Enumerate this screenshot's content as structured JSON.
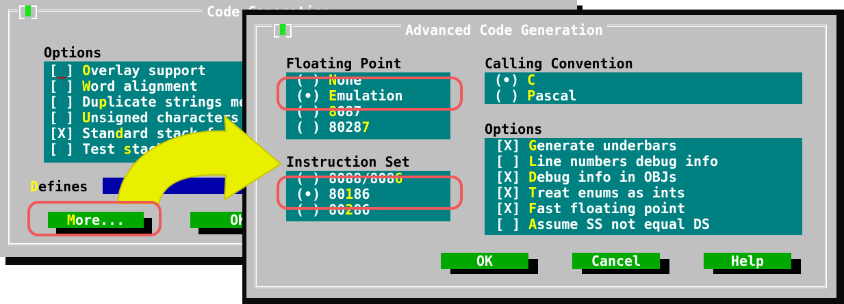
{
  "back_dialog": {
    "title": "Code Generation",
    "options_label": "Options",
    "options": [
      {
        "mark": "[_]",
        "hotkey": "O",
        "rest": "verlay support"
      },
      {
        "mark": "[ ]",
        "hotkey": "W",
        "rest": "ord alignment"
      },
      {
        "mark": "[ ]",
        "pre": "Du",
        "hotkey": "p",
        "rest": "licate strings merged"
      },
      {
        "mark": "[ ]",
        "hotkey": "U",
        "rest": "nsigned characters"
      },
      {
        "mark": "[X]",
        "pre": "Stan",
        "hotkey": "d",
        "rest": "ard stack frame"
      },
      {
        "mark": "[ ]",
        "pre": "Test ",
        "hotkey": "s",
        "rest": "tack overflow"
      }
    ],
    "defines_hotkey": "D",
    "defines_rest": "efines",
    "more_hotkey": "M",
    "more_rest": "ore...",
    "ok_label": "OK"
  },
  "front_dialog": {
    "title": "Advanced Code Generation",
    "floating_point": {
      "label": "Floating Point",
      "items": [
        {
          "mark": "( )",
          "hotkey": "N",
          "rest": "one"
        },
        {
          "mark": "(•)",
          "hotkey": "E",
          "rest": "mulation"
        },
        {
          "mark": "( )",
          "pre": "",
          "hotkey": "8",
          "rest": "087"
        },
        {
          "mark": "( )",
          "pre": "8028",
          "hotkey": "7",
          "rest": ""
        }
      ]
    },
    "calling_convention": {
      "label": "Calling Convention",
      "items": [
        {
          "mark": "(•)",
          "hotkey": "C",
          "rest": ""
        },
        {
          "mark": "( )",
          "hotkey": "P",
          "rest": "ascal"
        }
      ]
    },
    "instruction_set": {
      "label": "Instruction Set",
      "items": [
        {
          "mark": "( )",
          "pre": "8088/808",
          "hotkey": "6",
          "rest": ""
        },
        {
          "mark": "(•)",
          "pre": "80",
          "hotkey": "1",
          "rest": "86"
        },
        {
          "mark": "( )",
          "pre": "80",
          "hotkey": "2",
          "rest": "86"
        }
      ]
    },
    "options": {
      "label": "Options",
      "items": [
        {
          "mark": "[X]",
          "hotkey": "G",
          "rest": "enerate underbars"
        },
        {
          "mark": "[ ]",
          "hotkey": "L",
          "rest": "ine numbers debug info"
        },
        {
          "mark": "[X]",
          "hotkey": "D",
          "rest": "ebug info in OBJs"
        },
        {
          "mark": "[X]",
          "hotkey": "T",
          "rest": "reat enums as ints"
        },
        {
          "mark": "[X]",
          "hotkey": "F",
          "rest": "ast floating point"
        },
        {
          "mark": "[ ]",
          "hotkey": "A",
          "rest": "ssume SS not equal DS"
        }
      ]
    },
    "buttons": {
      "ok": "OK",
      "cancel": "Cancel",
      "help": "Help"
    }
  },
  "colors": {
    "dialog_bg": "#c0c0c0",
    "group_bg": "#008080",
    "button_bg": "#00a800",
    "hotkey": "#ffff00",
    "highlight_ring": "#f0585a",
    "arrow": "#e8f000"
  }
}
